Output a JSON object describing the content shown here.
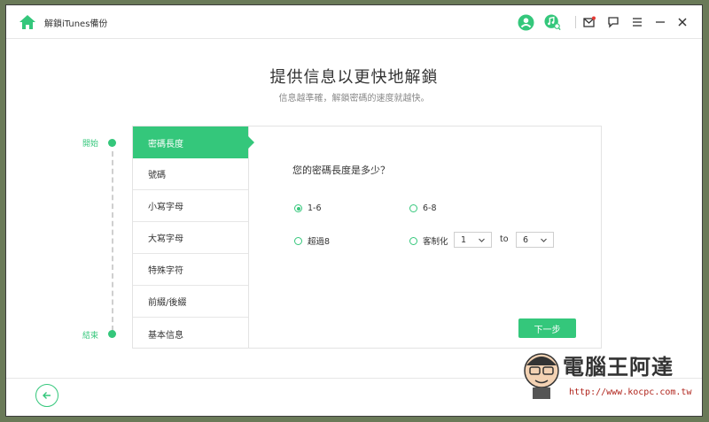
{
  "app": {
    "title": "解鎖iTunes備份"
  },
  "titlebar": {
    "icons": [
      "home-icon",
      "user-icon",
      "music-search-icon",
      "mail-icon",
      "feedback-icon",
      "menu-icon",
      "minimize-icon",
      "close-icon"
    ],
    "accent": "#34c77b"
  },
  "main": {
    "heading": "提供信息以更快地解鎖",
    "subheading": "信息越準確，解鎖密碼的速度就越快。"
  },
  "steps": {
    "start_label": "開始",
    "end_label": "結束"
  },
  "nav": {
    "items": [
      {
        "label": "密碼長度",
        "active": true
      },
      {
        "label": "號碼",
        "active": false
      },
      {
        "label": "小寫字母",
        "active": false
      },
      {
        "label": "大寫字母",
        "active": false
      },
      {
        "label": "特殊字符",
        "active": false
      },
      {
        "label": "前綴/後綴",
        "active": false
      },
      {
        "label": "基本信息",
        "active": false
      }
    ]
  },
  "form": {
    "question": "您的密碼長度是多少？",
    "options": [
      {
        "label": "1-6",
        "selected": true
      },
      {
        "label": "6-8",
        "selected": false
      },
      {
        "label": "超過8",
        "selected": false
      },
      {
        "label": "客制化",
        "selected": false
      }
    ],
    "custom_from": "1",
    "to_label": "to",
    "custom_to": "6",
    "next_label": "下一步"
  },
  "footer": {
    "back_icon": "arrow-left-icon"
  },
  "watermark": {
    "title": "電腦王阿達",
    "url": "http://www.kocpc.com.tw"
  }
}
